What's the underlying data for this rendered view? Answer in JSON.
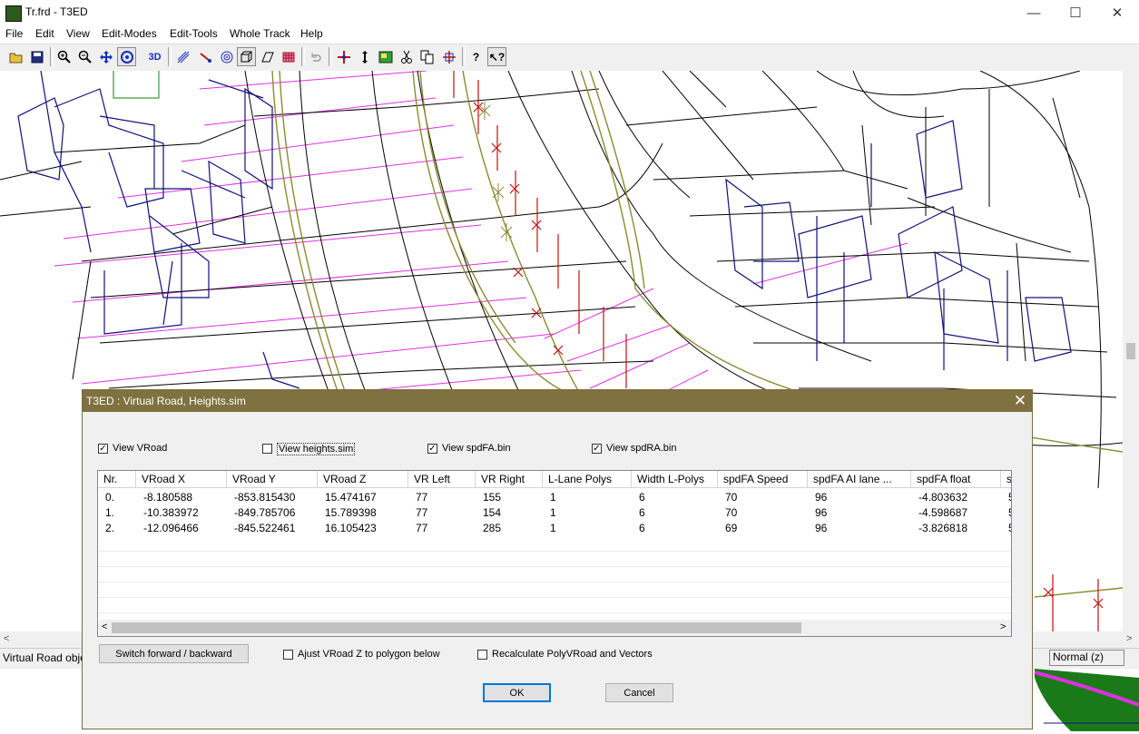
{
  "window": {
    "title": "Tr.frd - T3ED",
    "minimize_glyph": "—",
    "maximize_glyph": "☐",
    "close_glyph": "✕"
  },
  "menu": [
    "File",
    "Edit",
    "View",
    "Edit-Modes",
    "Edit-Tools",
    "Whole Track",
    "Help"
  ],
  "toolbar": {
    "icons": [
      "open-icon",
      "save-icon",
      "zoom-in-icon",
      "zoom-out-icon",
      "move-icon",
      "rotate-icon",
      "3d-icon",
      "select-icon",
      "line-icon",
      "target-icon",
      "cube-icon",
      "plane-icon",
      "grid-icon",
      "undo-icon",
      "crosshair-icon",
      "vertical-arrow-icon",
      "image-icon",
      "cut-icon",
      "copy-icon",
      "paste-icon",
      "help-icon",
      "context-help-icon"
    ],
    "label_3d": "3D"
  },
  "statusbar": {
    "left": "Virtual Road obje",
    "right": "Normal (z)"
  },
  "dialog": {
    "title": "T3ED : Virtual Road, Heights.sim",
    "checkboxes": [
      {
        "label": "View VRoad",
        "checked": true
      },
      {
        "label": "View heights.sim",
        "checked": false
      },
      {
        "label": "View spdFA.bin",
        "checked": true
      },
      {
        "label": "View spdRA.bin",
        "checked": true
      }
    ],
    "table": {
      "headers": [
        "Nr.",
        "VRoad X",
        "VRoad Y",
        "VRoad Z",
        "VR Left",
        "VR Right",
        "L-Lane Polys",
        "Width L-Polys",
        "spdFA Speed",
        "spdFA AI lane ...",
        "spdFA float",
        "s"
      ],
      "rows": [
        [
          "0.",
          "-8.180588",
          "-853.815430",
          "15.474167",
          "77",
          "155",
          "1",
          "6",
          "70",
          "96",
          "-4.803632",
          "5"
        ],
        [
          "1.",
          "-10.383972",
          "-849.785706",
          "15.789398",
          "77",
          "154",
          "1",
          "6",
          "70",
          "96",
          "-4.598687",
          "5"
        ],
        [
          "2.",
          "-12.096466",
          "-845.522461",
          "16.105423",
          "77",
          "285",
          "1",
          "6",
          "69",
          "96",
          "-3.826818",
          "5"
        ]
      ]
    },
    "switch_button": "Switch forward / backward",
    "adjust_checkbox": {
      "label": "Ajust VRoad Z to polygon below",
      "checked": false
    },
    "recalc_checkbox": {
      "label": "Recalculate PolyVRoad and Vectors",
      "checked": false
    },
    "ok_button": "OK",
    "cancel_button": "Cancel"
  },
  "colors": {
    "dialog_titlebar": "#7f7140",
    "wire_black": "#000000",
    "wire_navy": "#10107a",
    "wire_magenta": "#e030e0",
    "wire_olive": "#8a8a30",
    "wire_red": "#c01010",
    "green_fill": "#1a7a1a"
  }
}
